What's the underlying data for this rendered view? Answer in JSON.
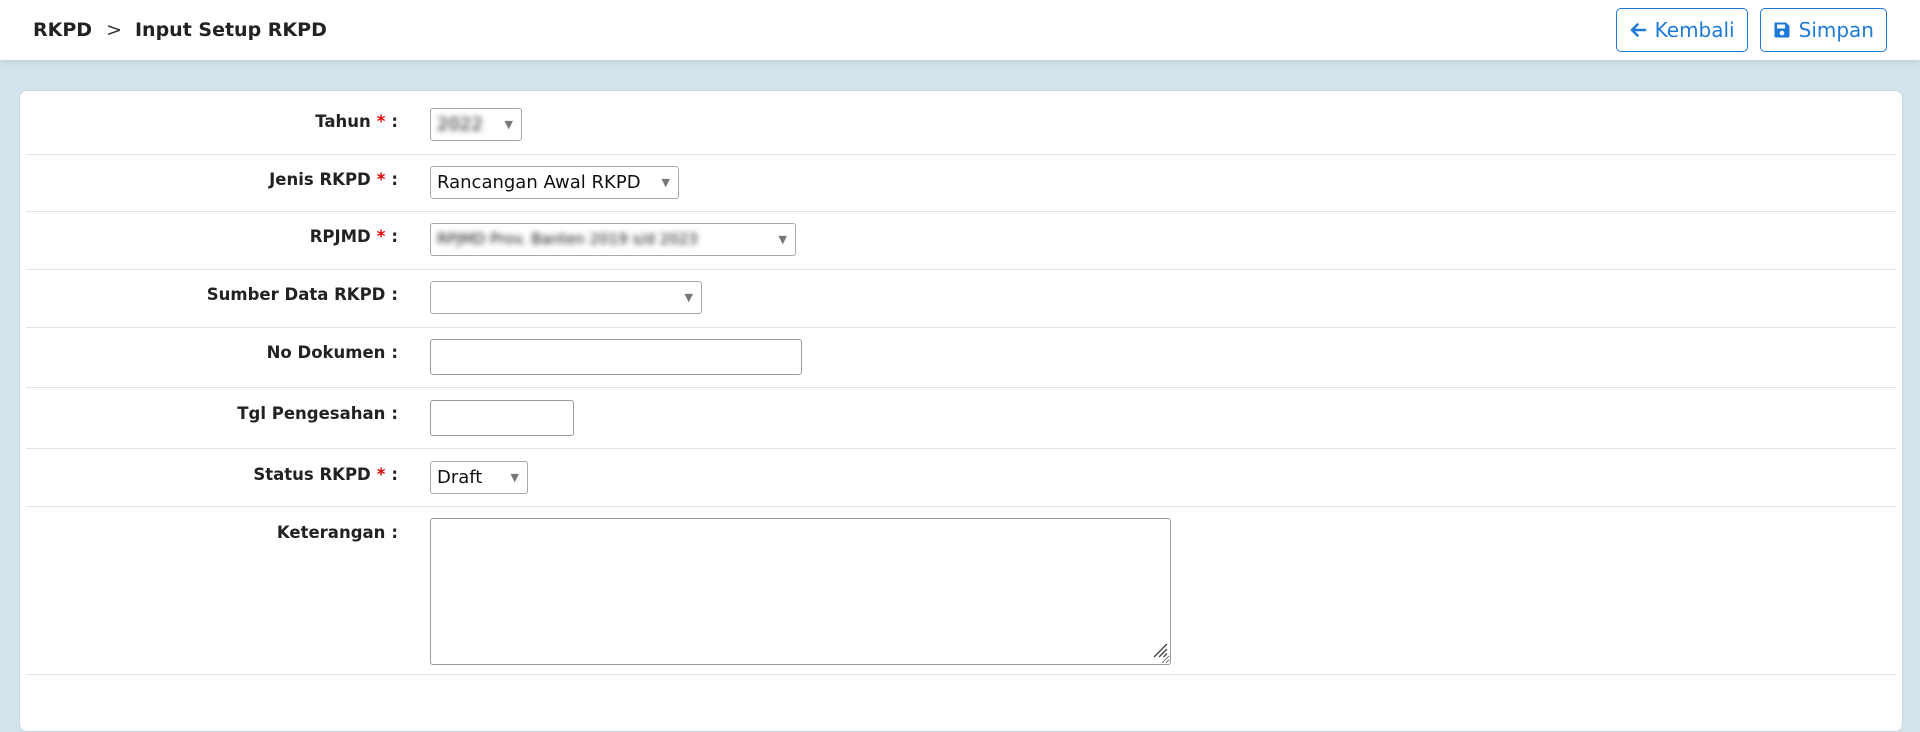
{
  "breadcrumb": {
    "root": "RKPD",
    "separator": ">",
    "current": "Input Setup RKPD"
  },
  "toolbar": {
    "back_label": "Kembali",
    "save_label": "Simpan",
    "accent_color": "#1e7ad6"
  },
  "form": {
    "required_marker": "*",
    "colon": ":",
    "tahun": {
      "label": "Tahun",
      "value": "2022"
    },
    "jenis": {
      "label": "Jenis RKPD",
      "value": "Rancangan Awal RKPD"
    },
    "rpjmd": {
      "label": "RPJMD",
      "value": "RPJMD Prov. Banten 2019 s/d 2023"
    },
    "sumber": {
      "label": "Sumber Data RKPD",
      "value": ""
    },
    "no_dokumen": {
      "label": "No Dokumen",
      "value": ""
    },
    "tgl": {
      "label": "Tgl Pengesahan",
      "value": ""
    },
    "status": {
      "label": "Status RKPD",
      "value": "Draft"
    },
    "keterangan": {
      "label": "Keterangan",
      "value": ""
    }
  }
}
